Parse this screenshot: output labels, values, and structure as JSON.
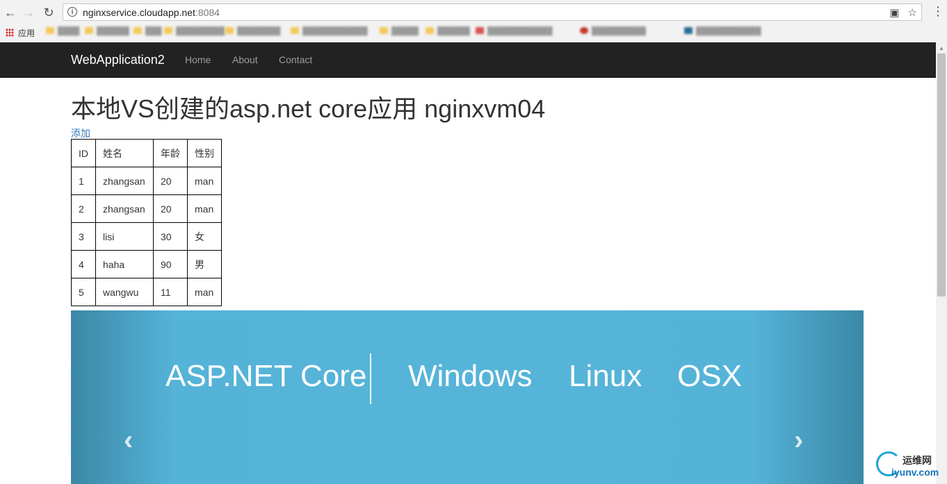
{
  "browser": {
    "url_host": "nginxservice.cloudapp.net",
    "url_port": ":8084",
    "apps_label": "应用"
  },
  "navbar": {
    "brand": "WebApplication2",
    "links": [
      "Home",
      "About",
      "Contact"
    ]
  },
  "page": {
    "title": "本地VS创建的asp.net core应用 nginxvm04",
    "add_link": "添加"
  },
  "table": {
    "headers": [
      "ID",
      "姓名",
      "年龄",
      "性别"
    ],
    "rows": [
      [
        "1",
        "zhangsan",
        "20",
        "man"
      ],
      [
        "2",
        "zhangsan",
        "20",
        "man"
      ],
      [
        "3",
        "lisi",
        "30",
        "女"
      ],
      [
        "4",
        "haha",
        "90",
        "男"
      ],
      [
        "5",
        "wangwu",
        "11",
        "man"
      ]
    ]
  },
  "carousel": {
    "items": [
      "ASP.NET Core",
      "Windows",
      "Linux",
      "OSX"
    ]
  },
  "watermark": {
    "cn": "运维网",
    "en": "iyunv.com"
  }
}
